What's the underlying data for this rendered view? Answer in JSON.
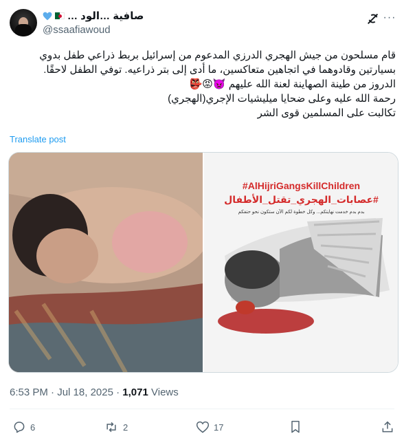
{
  "author": {
    "display_name": "صافية …الود …",
    "handle": "@ssaafiawoud"
  },
  "header_icons": [
    "grok-icon",
    "more-icon"
  ],
  "tweet": {
    "lines": [
      "قام مسلحون من جيش الهجري الدرزي المدعوم من إسرائيل بربط ذراعي طفل بدوي",
      "بسيارتين وقادوهما في اتجاهين متعاكسين، ما أدى إلى بتر ذراعيه. توفي الطفل لاحقًا.",
      "الدروز من طينة الصهاينة لعنة الله عليهم 👿😡👺",
      "رحمة الله عليه وعلى ضحايا ميليشيات الإجري(الهجري)",
      "تكالبت على المسلمين قوى الشر"
    ],
    "translate_label": "Translate post"
  },
  "media": {
    "image2": {
      "hashtag_en": "#AlHijriGangsKillChildren",
      "hashtag_ar": "#عصابات_الهجري_تقتل_الأطفال",
      "caption": "بدم بدم خدمت نهايتكم... وكل خطوة لكم الآن ستكون نحو حتفكم"
    }
  },
  "meta": {
    "time": "6:53 PM",
    "separator": "·",
    "date": "Jul 18, 2025",
    "views_count": "1,071",
    "views_label": "Views"
  },
  "actions": {
    "replies": "6",
    "reposts": "2",
    "likes": "17"
  },
  "colors": {
    "accent": "#1d9bf0",
    "secondary_text": "#536471",
    "primary_text": "#0f1419",
    "border": "#cfd9de"
  }
}
